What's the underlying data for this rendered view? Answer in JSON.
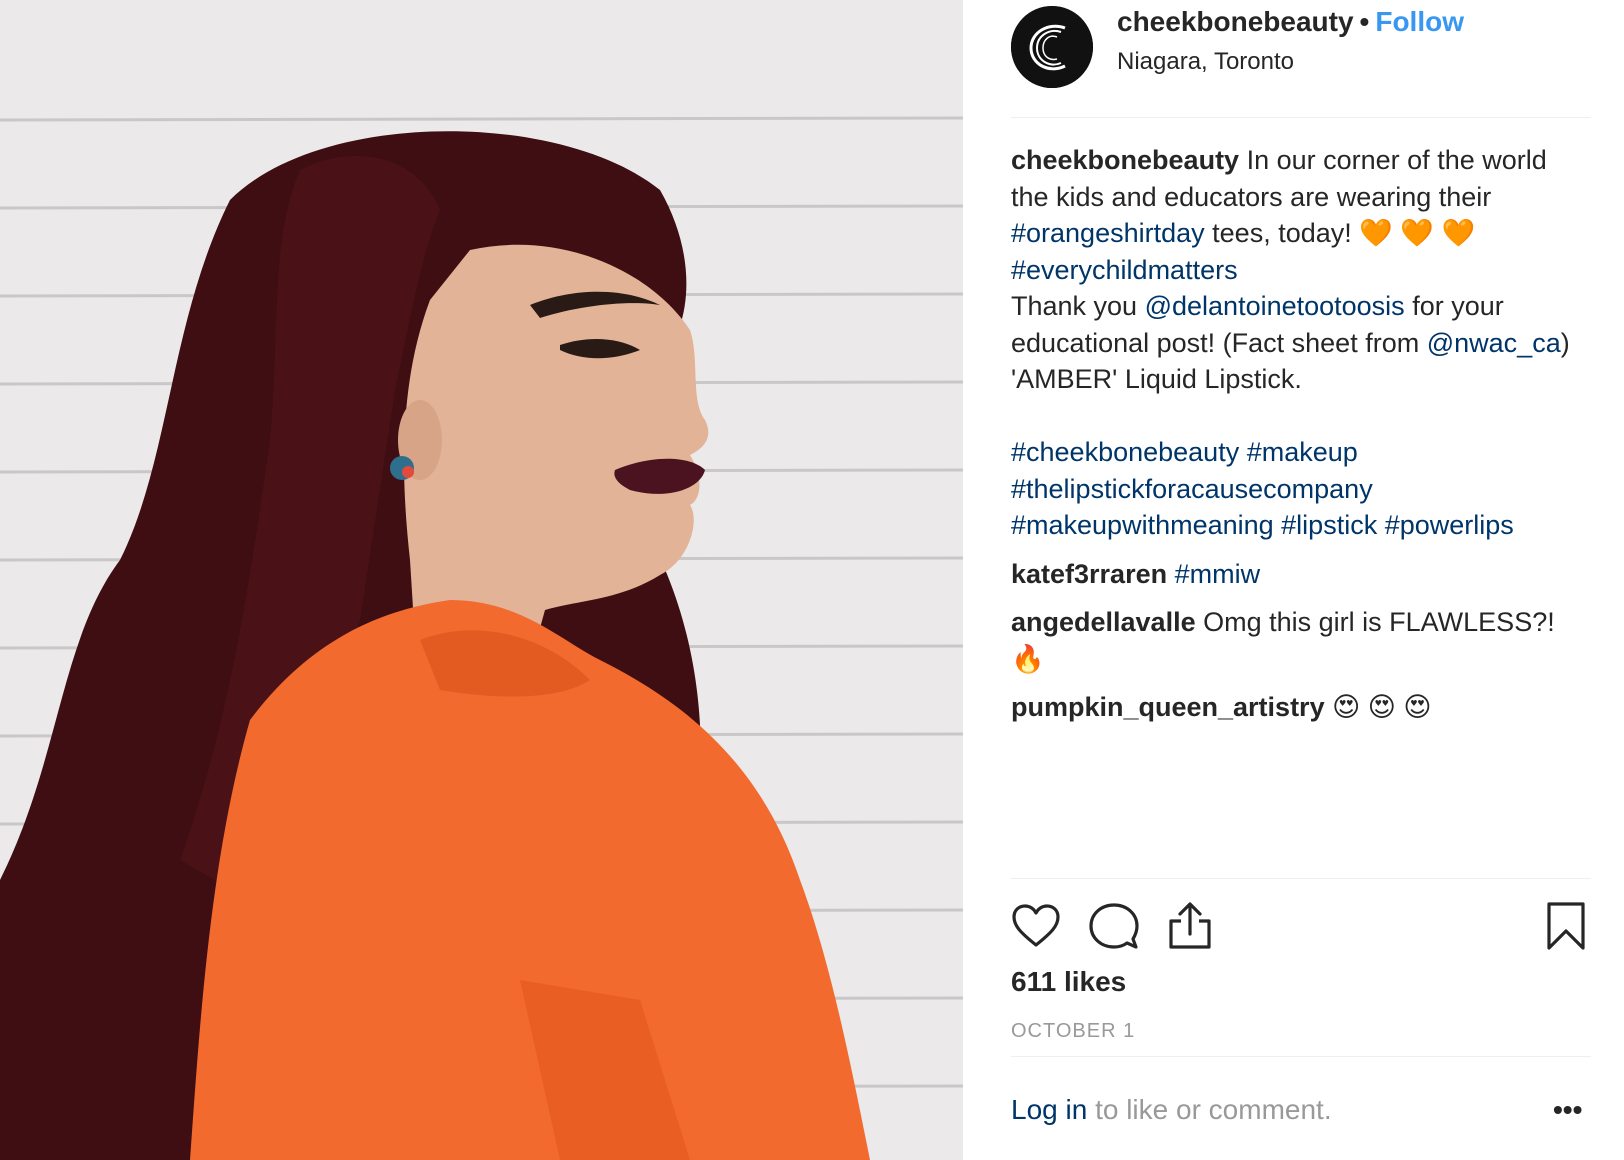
{
  "header": {
    "username": "cheekbonebeauty",
    "separator": "•",
    "follow_label": "Follow",
    "location": "Niagara, Toronto"
  },
  "caption": {
    "username": "cheekbonebeauty",
    "part1": "In our corner of the world the kids and educators are wearing their",
    "hashtag1": "#orangeshirtday",
    "part2": "tees, today! 🧡 🧡 🧡",
    "hashtag2": "#everychildmatters",
    "part3": "Thank you",
    "mention1": "@delantoinetootoosis",
    "part4": "for your educational post! (Fact sheet from",
    "mention2": "@nwac_ca",
    "part5": ") 'AMBER' Liquid Lipstick.",
    "tags": "#cheekbonebeauty #makeup #thelipstickforacausecompany #makeupwithmeaning #lipstick #powerlips"
  },
  "comments": [
    {
      "username": "katef3rraren",
      "text": "",
      "tag": "#mmiw"
    },
    {
      "username": "angedellavalle",
      "text": "Omg this girl is FLAWLESS?! 🔥",
      "tag": ""
    },
    {
      "username": "pumpkin_queen_artistry",
      "text": "😍 😍 😍",
      "tag": ""
    }
  ],
  "actions": {
    "icons": [
      "heart-icon",
      "comment-icon",
      "share-icon",
      "bookmark-icon"
    ]
  },
  "likes": "611 likes",
  "date": "OCTOBER 1",
  "footer": {
    "login_link": "Log in",
    "login_rest": "to like or comment.",
    "more": "•••"
  },
  "colors": {
    "link": "#003569",
    "follow": "#3897f0",
    "muted": "#999999",
    "hoodie": "#f26a2e",
    "hair": "#4a1216"
  }
}
